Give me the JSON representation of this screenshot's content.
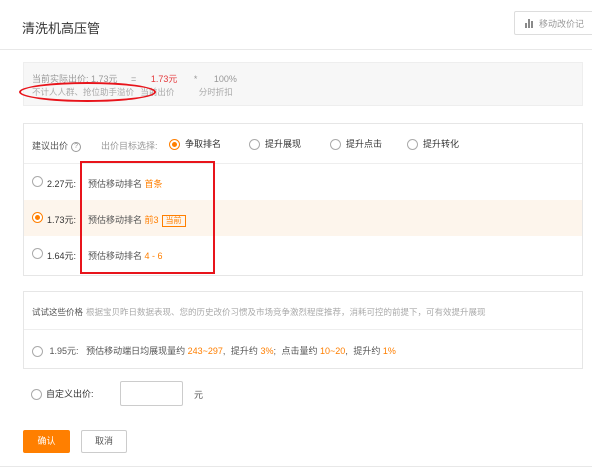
{
  "page": {
    "title": "清洗机高压管"
  },
  "history_button": {
    "label": "移动改价记",
    "icon": "bar-chart-icon"
  },
  "formula": {
    "actual_label": "当前实际出价: 1.73元",
    "equals": "=",
    "price": "1.73元",
    "times": "*",
    "discount": "100%",
    "note": "不计人人群、抢位助手溢价",
    "price_label": "当前出价",
    "discount_label": "分时折扣"
  },
  "suggest": {
    "label": "建议出价",
    "goal_label": "出价目标选择:",
    "goals": [
      "争取排名",
      "提升展现",
      "提升点击",
      "提升转化"
    ],
    "selected_goal": "争取排名",
    "options": [
      {
        "price": "2.27元:",
        "pred_label": "预估移动排名",
        "rank": "首条",
        "tag": ""
      },
      {
        "price": "1.73元:",
        "pred_label": "预估移动排名",
        "rank": "前3",
        "tag": "当前"
      },
      {
        "price": "1.64元:",
        "pred_label": "预估移动排名",
        "rank": "4 - 6",
        "tag": ""
      }
    ],
    "selected_index": 1
  },
  "try_price": {
    "title": "试试这些价格",
    "desc": "根据宝贝昨日数据表现、您的历史改价习惯及市场竞争激烈程度推荐，消耗可控的前提下，可有效提升展现",
    "option": {
      "price": "1.95元:",
      "exp_label": "预估移动端日均展现量约",
      "exp_value": "243~297",
      "exp_lift_label": "提升约",
      "exp_lift": "3%",
      "click_label": "点击量约",
      "click_value": "10~20",
      "click_lift_label": "提升约",
      "click_lift": "1%"
    }
  },
  "custom": {
    "label": "自定义出价:",
    "value": "",
    "unit": "元"
  },
  "actions": {
    "confirm": "确认",
    "cancel": "取消"
  },
  "colors": {
    "accent": "#ff7f00",
    "annotation": "#e8141b",
    "price_red": "#e4393c"
  }
}
